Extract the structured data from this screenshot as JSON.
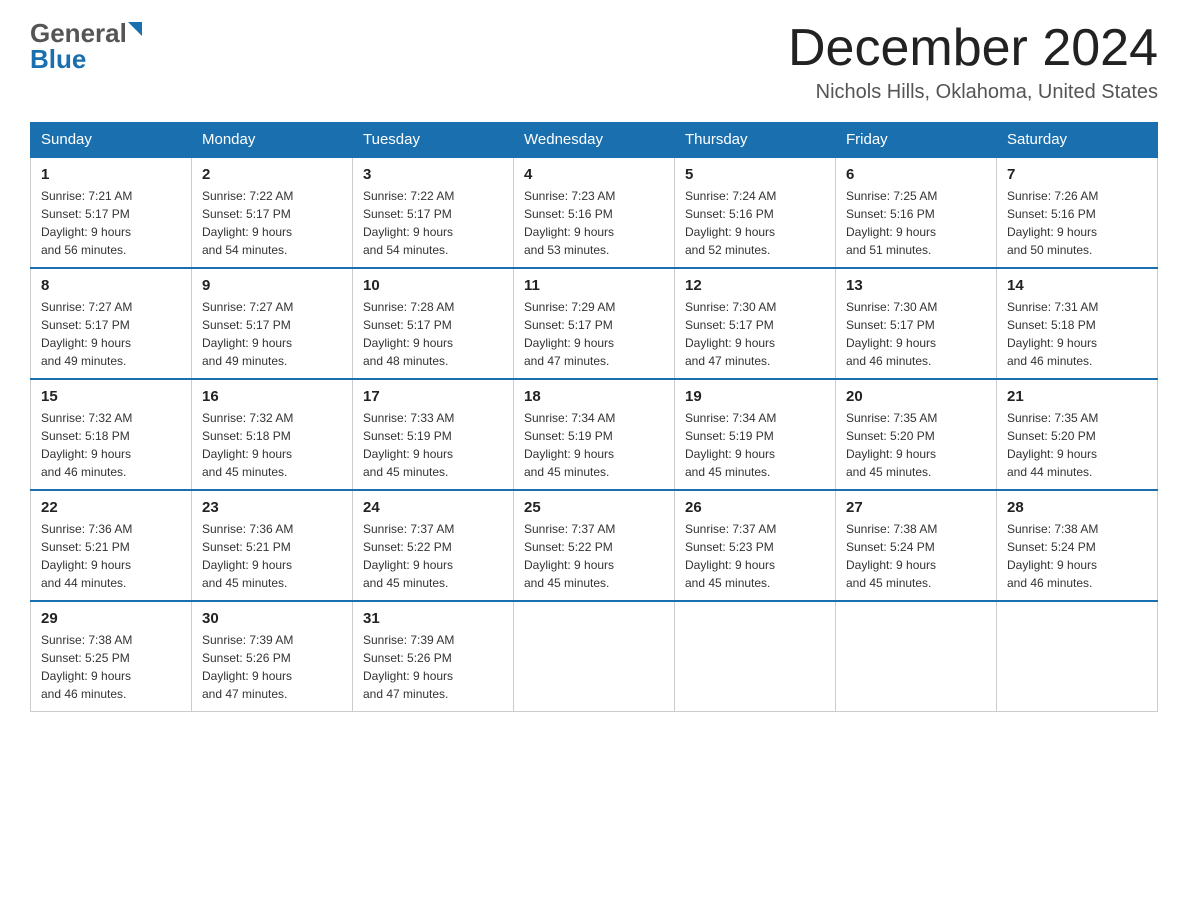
{
  "header": {
    "month_title": "December 2024",
    "location": "Nichols Hills, Oklahoma, United States",
    "logo_general": "General",
    "logo_blue": "Blue"
  },
  "weekdays": [
    "Sunday",
    "Monday",
    "Tuesday",
    "Wednesday",
    "Thursday",
    "Friday",
    "Saturday"
  ],
  "weeks": [
    [
      {
        "day": "1",
        "sunrise": "7:21 AM",
        "sunset": "5:17 PM",
        "daylight": "9 hours and 56 minutes."
      },
      {
        "day": "2",
        "sunrise": "7:22 AM",
        "sunset": "5:17 PM",
        "daylight": "9 hours and 54 minutes."
      },
      {
        "day": "3",
        "sunrise": "7:22 AM",
        "sunset": "5:17 PM",
        "daylight": "9 hours and 54 minutes."
      },
      {
        "day": "4",
        "sunrise": "7:23 AM",
        "sunset": "5:16 PM",
        "daylight": "9 hours and 53 minutes."
      },
      {
        "day": "5",
        "sunrise": "7:24 AM",
        "sunset": "5:16 PM",
        "daylight": "9 hours and 52 minutes."
      },
      {
        "day": "6",
        "sunrise": "7:25 AM",
        "sunset": "5:16 PM",
        "daylight": "9 hours and 51 minutes."
      },
      {
        "day": "7",
        "sunrise": "7:26 AM",
        "sunset": "5:16 PM",
        "daylight": "9 hours and 50 minutes."
      }
    ],
    [
      {
        "day": "8",
        "sunrise": "7:27 AM",
        "sunset": "5:17 PM",
        "daylight": "9 hours and 49 minutes."
      },
      {
        "day": "9",
        "sunrise": "7:27 AM",
        "sunset": "5:17 PM",
        "daylight": "9 hours and 49 minutes."
      },
      {
        "day": "10",
        "sunrise": "7:28 AM",
        "sunset": "5:17 PM",
        "daylight": "9 hours and 48 minutes."
      },
      {
        "day": "11",
        "sunrise": "7:29 AM",
        "sunset": "5:17 PM",
        "daylight": "9 hours and 47 minutes."
      },
      {
        "day": "12",
        "sunrise": "7:30 AM",
        "sunset": "5:17 PM",
        "daylight": "9 hours and 47 minutes."
      },
      {
        "day": "13",
        "sunrise": "7:30 AM",
        "sunset": "5:17 PM",
        "daylight": "9 hours and 46 minutes."
      },
      {
        "day": "14",
        "sunrise": "7:31 AM",
        "sunset": "5:18 PM",
        "daylight": "9 hours and 46 minutes."
      }
    ],
    [
      {
        "day": "15",
        "sunrise": "7:32 AM",
        "sunset": "5:18 PM",
        "daylight": "9 hours and 46 minutes."
      },
      {
        "day": "16",
        "sunrise": "7:32 AM",
        "sunset": "5:18 PM",
        "daylight": "9 hours and 45 minutes."
      },
      {
        "day": "17",
        "sunrise": "7:33 AM",
        "sunset": "5:19 PM",
        "daylight": "9 hours and 45 minutes."
      },
      {
        "day": "18",
        "sunrise": "7:34 AM",
        "sunset": "5:19 PM",
        "daylight": "9 hours and 45 minutes."
      },
      {
        "day": "19",
        "sunrise": "7:34 AM",
        "sunset": "5:19 PM",
        "daylight": "9 hours and 45 minutes."
      },
      {
        "day": "20",
        "sunrise": "7:35 AM",
        "sunset": "5:20 PM",
        "daylight": "9 hours and 45 minutes."
      },
      {
        "day": "21",
        "sunrise": "7:35 AM",
        "sunset": "5:20 PM",
        "daylight": "9 hours and 44 minutes."
      }
    ],
    [
      {
        "day": "22",
        "sunrise": "7:36 AM",
        "sunset": "5:21 PM",
        "daylight": "9 hours and 44 minutes."
      },
      {
        "day": "23",
        "sunrise": "7:36 AM",
        "sunset": "5:21 PM",
        "daylight": "9 hours and 45 minutes."
      },
      {
        "day": "24",
        "sunrise": "7:37 AM",
        "sunset": "5:22 PM",
        "daylight": "9 hours and 45 minutes."
      },
      {
        "day": "25",
        "sunrise": "7:37 AM",
        "sunset": "5:22 PM",
        "daylight": "9 hours and 45 minutes."
      },
      {
        "day": "26",
        "sunrise": "7:37 AM",
        "sunset": "5:23 PM",
        "daylight": "9 hours and 45 minutes."
      },
      {
        "day": "27",
        "sunrise": "7:38 AM",
        "sunset": "5:24 PM",
        "daylight": "9 hours and 45 minutes."
      },
      {
        "day": "28",
        "sunrise": "7:38 AM",
        "sunset": "5:24 PM",
        "daylight": "9 hours and 46 minutes."
      }
    ],
    [
      {
        "day": "29",
        "sunrise": "7:38 AM",
        "sunset": "5:25 PM",
        "daylight": "9 hours and 46 minutes."
      },
      {
        "day": "30",
        "sunrise": "7:39 AM",
        "sunset": "5:26 PM",
        "daylight": "9 hours and 47 minutes."
      },
      {
        "day": "31",
        "sunrise": "7:39 AM",
        "sunset": "5:26 PM",
        "daylight": "9 hours and 47 minutes."
      },
      null,
      null,
      null,
      null
    ]
  ],
  "labels": {
    "sunrise": "Sunrise:",
    "sunset": "Sunset:",
    "daylight": "Daylight:"
  }
}
